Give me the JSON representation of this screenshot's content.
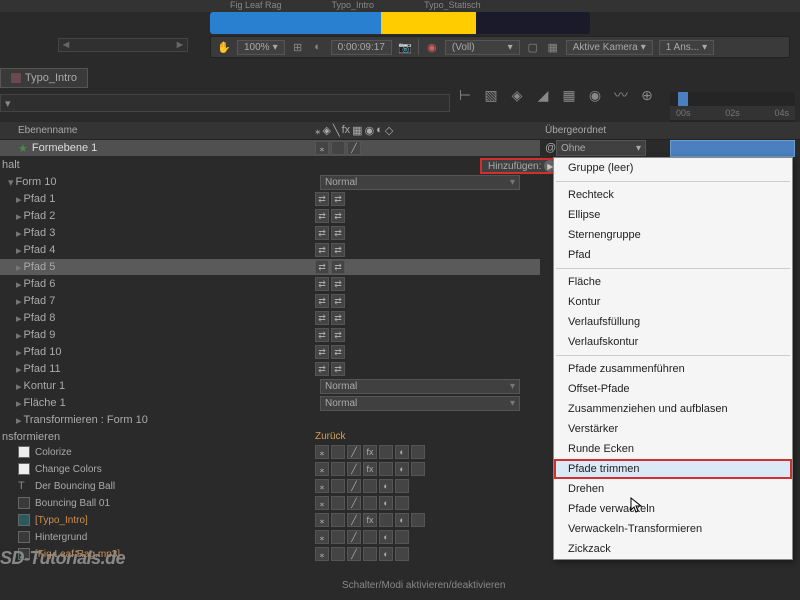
{
  "top_tabs": {
    "t1": "Fig Leaf Rag",
    "t2": "Typo_Intro",
    "t3": "Typo_Statisch"
  },
  "viewer": {
    "zoom": "100%",
    "time": "0:00:09:17",
    "quality": "(Voll)",
    "camera": "Aktive Kamera",
    "views": "1 Ans..."
  },
  "comp_tab": "Typo_Intro",
  "headers": {
    "name": "Ebenenname",
    "parent": "Übergeordnet"
  },
  "shape_layer": "Formebene 1",
  "parent_none": "Ohne",
  "add_button": "Hinzufügen:",
  "group": "Form 10",
  "mode_normal": "Normal",
  "paths": [
    "Pfad 1",
    "Pfad 2",
    "Pfad 3",
    "Pfad 4",
    "Pfad 5",
    "Pfad 6",
    "Pfad 7",
    "Pfad 8",
    "Pfad 9",
    "Pfad 10",
    "Pfad 11"
  ],
  "kontur": "Kontur 1",
  "flaeche": "Fläche 1",
  "transform_group": "Transformieren : Form 10",
  "transform_header": "nsformieren",
  "reset_link": "Zurück",
  "effects": [
    {
      "name": "Colorize",
      "type": "white"
    },
    {
      "name": "Change Colors",
      "type": "white"
    },
    {
      "name": "Der Bouncing Ball",
      "type": "txt",
      "glyph": "T"
    },
    {
      "name": "Bouncing Ball 01",
      "type": "dash"
    },
    {
      "name": "[Typo_Intro]",
      "type": "teal",
      "bracket": true
    },
    {
      "name": "Hintergrund",
      "type": "dash"
    },
    {
      "name": "[Fig Leaf Rag.mp3]",
      "type": "audio",
      "glyph": "♪",
      "bracket": true
    }
  ],
  "watermark": "SD-Tutorials.de",
  "footer": "Schalter/Modi aktivieren/deaktivieren",
  "ruler": {
    "t1": "00s",
    "t2": "02s",
    "t3": "04s"
  },
  "context_menu": {
    "g1": [
      "Gruppe (leer)"
    ],
    "g2": [
      "Rechteck",
      "Ellipse",
      "Sternengruppe",
      "Pfad"
    ],
    "g3": [
      "Fläche",
      "Kontur",
      "Verlaufsfüllung",
      "Verlaufskontur"
    ],
    "g4": [
      "Pfade zusammenführen",
      "Offset-Pfade",
      "Zusammenziehen und aufblasen",
      "Verstärker",
      "Runde Ecken",
      "Pfade trimmen",
      "Drehen",
      "Pfade verwackeln",
      "Verwackeln-Transformieren",
      "Zickzack"
    ],
    "highlighted": "Pfade trimmen"
  }
}
